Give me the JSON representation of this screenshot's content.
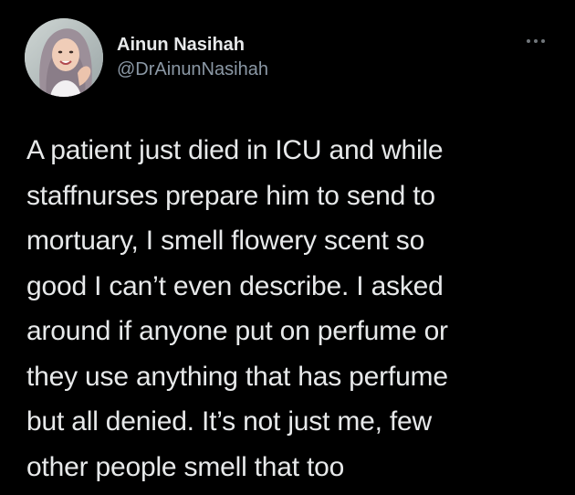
{
  "author": {
    "display_name": "Ainun Nasihah",
    "handle": "@DrAinunNasihah"
  },
  "menu": {
    "icon": "more-options-icon"
  },
  "tweet": {
    "text": "A patient just died in ICU and while\nstaffnurses prepare him to send to\nmortuary, I smell flowery scent so\ngood I can’t even describe. I asked\naround if anyone put on perfume or\nthey use anything that has perfume\nbut all denied. It’s not just me, few\nother people smell that too"
  },
  "colors": {
    "background": "#000000",
    "primary_text": "#e7e9ea",
    "secondary_text": "#8b98a5",
    "icon": "#71767b"
  }
}
